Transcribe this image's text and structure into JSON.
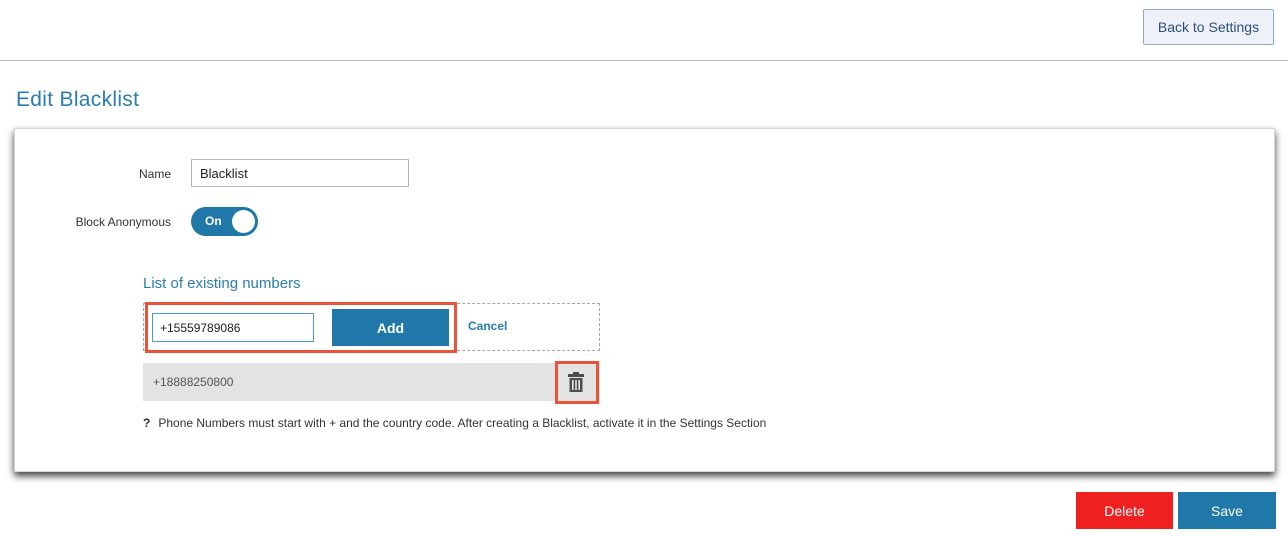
{
  "header": {
    "back_button_label": "Back to Settings"
  },
  "page": {
    "title": "Edit Blacklist"
  },
  "form": {
    "name_label": "Name",
    "name_value": "Blacklist",
    "block_anonymous_label": "Block Anonymous",
    "block_anonymous_state": "On"
  },
  "numbers": {
    "heading": "List of existing numbers",
    "new_number_value": "+15559789086",
    "add_button_label": "Add",
    "cancel_label": "Cancel",
    "items": [
      {
        "number": "+18888250800"
      }
    ]
  },
  "help": {
    "marker": "?",
    "text": "Phone Numbers must start with + and the country code. After creating a Blacklist, activate it in the Settings Section"
  },
  "footer": {
    "delete_label": "Delete",
    "save_label": "Save"
  },
  "icons": {
    "delete_number": "trash-icon"
  },
  "colors": {
    "accent": "#1f78a8",
    "danger": "#ee2020",
    "highlight": "#e8543a"
  }
}
